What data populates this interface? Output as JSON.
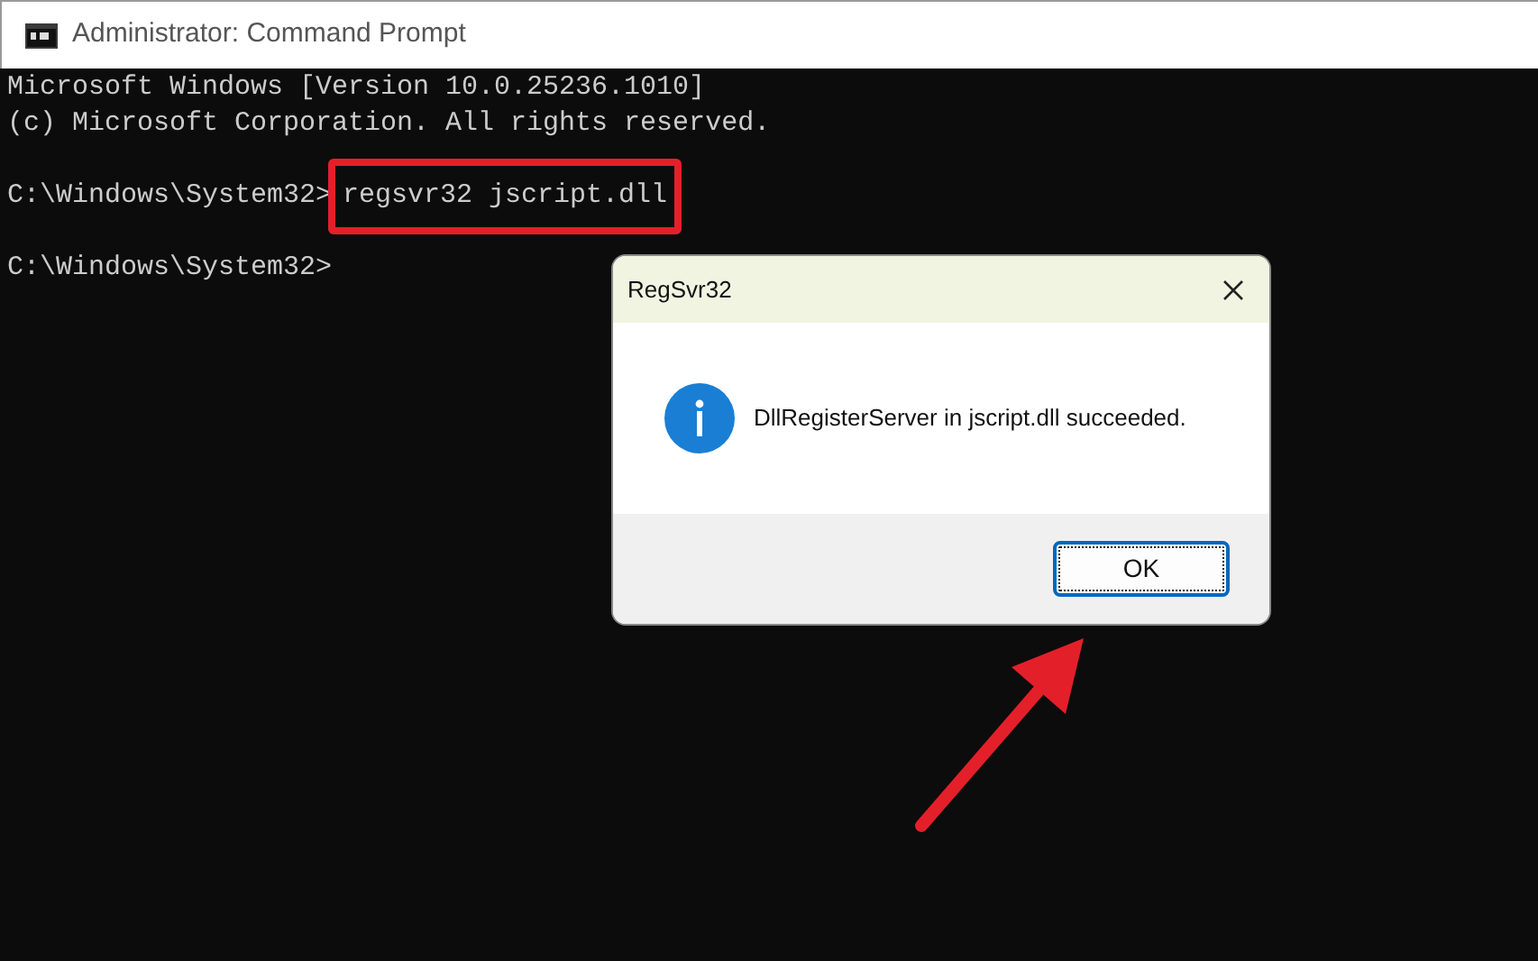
{
  "window": {
    "title": "Administrator: Command Prompt"
  },
  "console": {
    "lines": [
      {
        "kind": "output",
        "text": "Microsoft Windows [Version 10.0.25236.1010]"
      },
      {
        "kind": "output",
        "text": "(c) Microsoft Corporation. All rights reserved."
      },
      {
        "kind": "blank"
      },
      {
        "kind": "prompt",
        "prompt": "C:\\Windows\\System32>",
        "command": "regsvr32 jscript.dll",
        "highlighted": true
      },
      {
        "kind": "blank"
      },
      {
        "kind": "prompt",
        "prompt": "C:\\Windows\\System32>"
      }
    ]
  },
  "dialog": {
    "title": "RegSvr32",
    "message": "DllRegisterServer in jscript.dll succeeded.",
    "buttons": [
      {
        "label": "OK",
        "selected": true
      }
    ]
  }
}
